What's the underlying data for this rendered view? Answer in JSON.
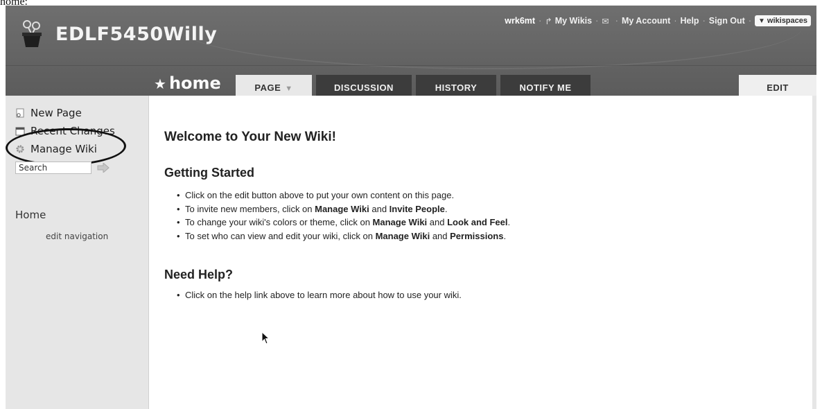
{
  "stray_text": "home:",
  "site": {
    "title": "EDLF5450Willy"
  },
  "topnav": {
    "user": "wrk6mt",
    "my_wikis": "My Wikis",
    "my_account": "My Account",
    "help": "Help",
    "sign_out": "Sign Out",
    "brand": "wikispaces",
    "separator": "·"
  },
  "page": {
    "star": "★",
    "name": "home"
  },
  "tabs": {
    "page": "PAGE",
    "page_caret": "▼",
    "discussion": "DISCUSSION",
    "history": "HISTORY",
    "notify": "NOTIFY ME",
    "edit": "EDIT"
  },
  "sidebar": {
    "new_page": "New Page",
    "recent_changes": "Recent Changes",
    "manage_wiki": "Manage Wiki",
    "search_value": "Search",
    "nav_home": "Home",
    "edit_navigation": "edit navigation"
  },
  "content": {
    "welcome": "Welcome to Your New Wiki!",
    "getting_started": {
      "heading": "Getting Started",
      "b1": "Click on the edit button above to put your own content on this page.",
      "b2_pre": "To invite new members, click on ",
      "b2_bold1": "Manage Wiki",
      "b2_mid": " and ",
      "b2_bold2": "Invite People",
      "b2_end": ".",
      "b3_pre": "To change your wiki's colors or theme, click on ",
      "b3_bold1": "Manage Wiki",
      "b3_mid": " and ",
      "b3_bold2": "Look and Feel",
      "b3_end": ".",
      "b4_pre": "To set who can view and edit your wiki, click on ",
      "b4_bold1": "Manage Wiki",
      "b4_mid": " and ",
      "b4_bold2": "Permissions",
      "b4_end": "."
    },
    "need_help": {
      "heading": "Need Help?",
      "b1": "Click on the help link above to learn more about how to use your wiki."
    }
  }
}
